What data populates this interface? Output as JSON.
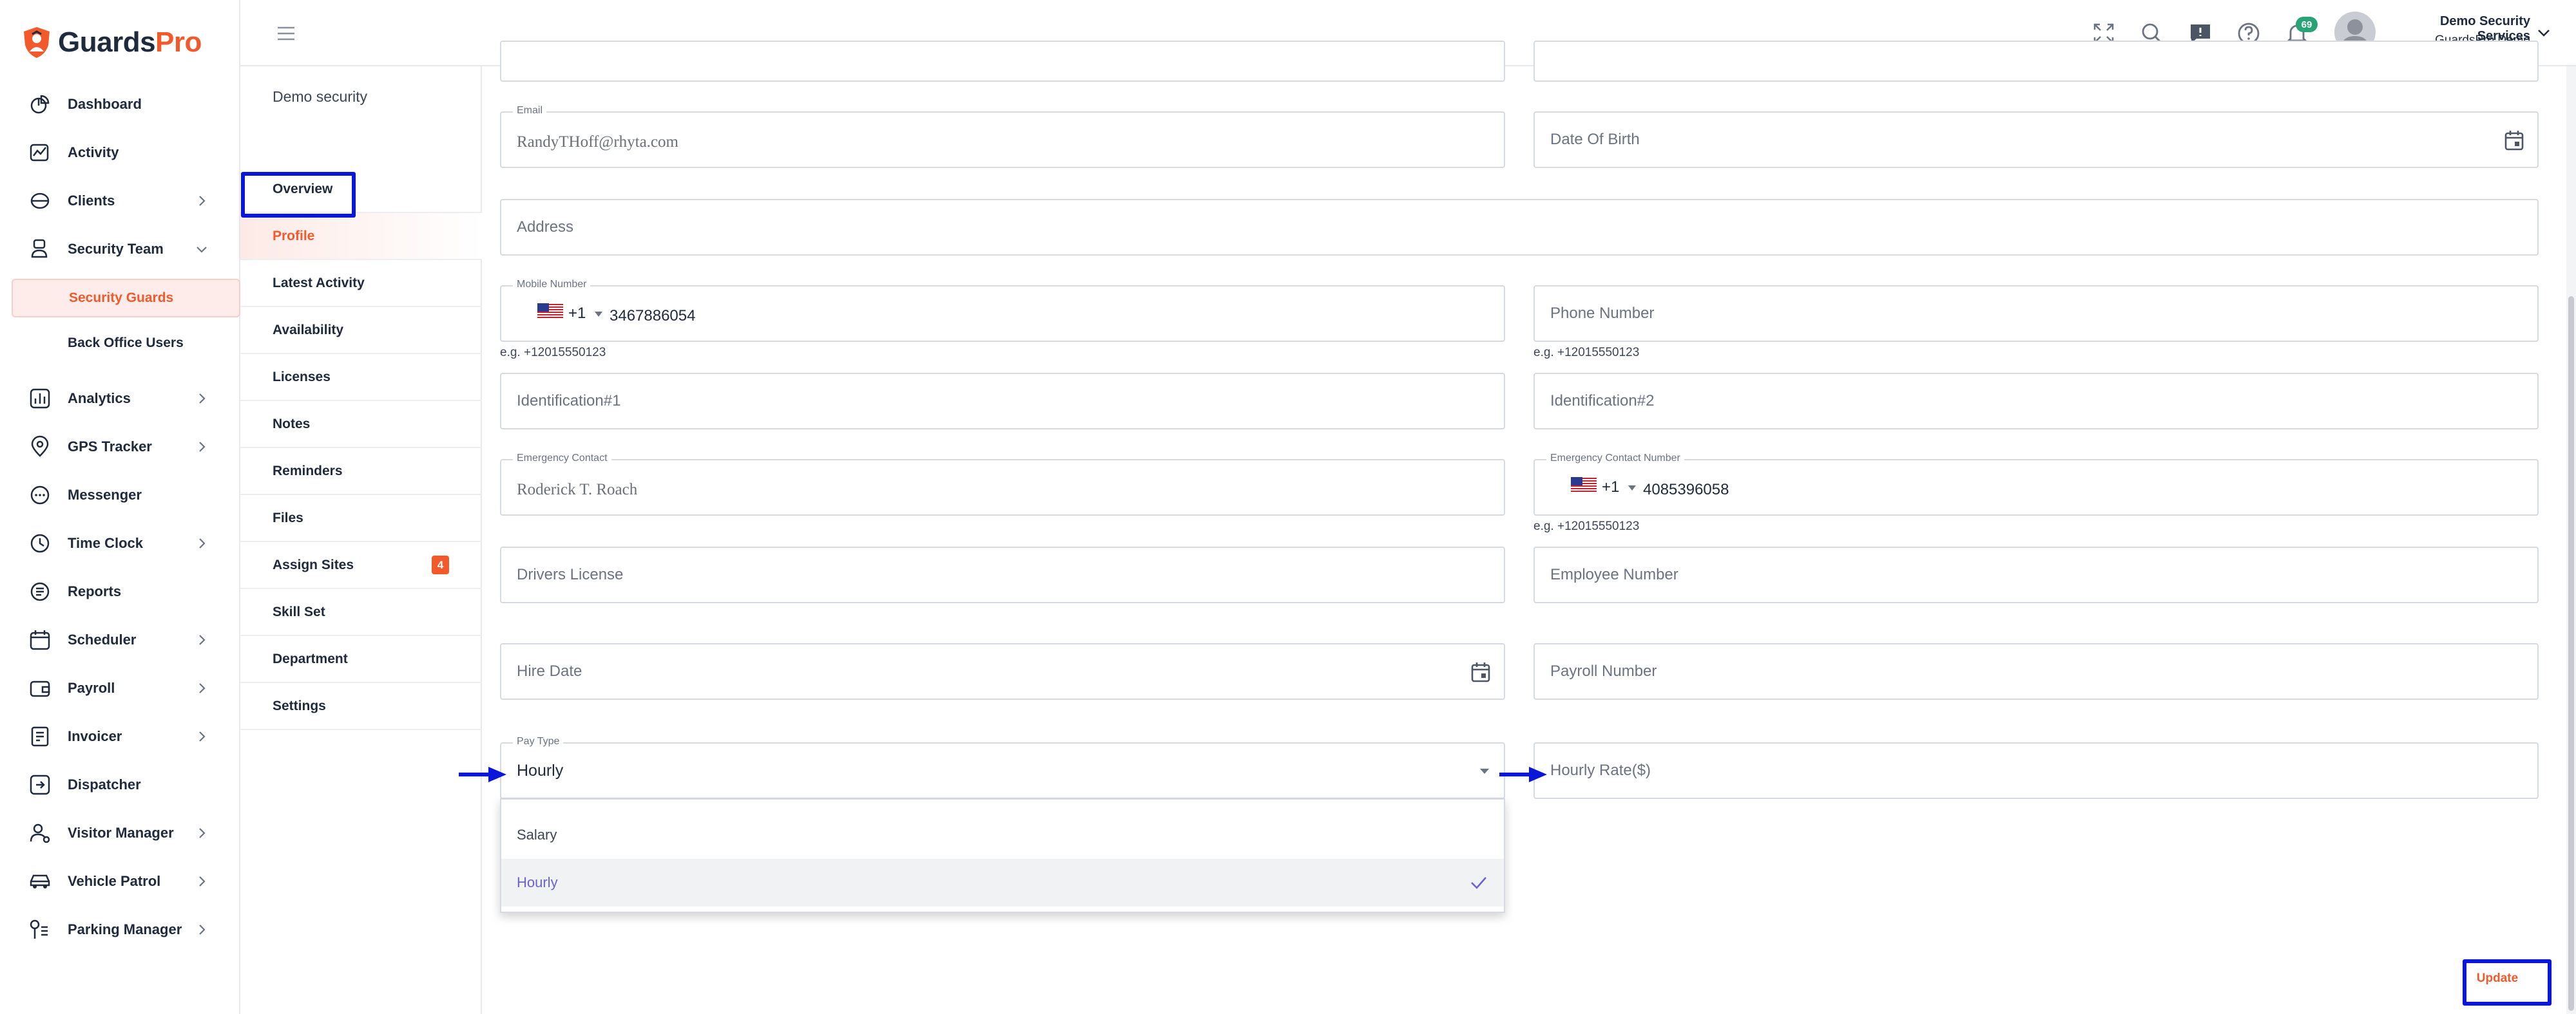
{
  "brand": {
    "name_part1": "Guards",
    "name_part2": "Pro",
    "primary_color": "#f25a2c",
    "text_color": "#1f2b3d",
    "highlight_color": "#0a16d8"
  },
  "sidebar": {
    "items": [
      {
        "label": "Dashboard",
        "icon": "dashboard-icon",
        "has_children": false
      },
      {
        "label": "Activity",
        "icon": "activity-icon",
        "has_children": false
      },
      {
        "label": "Clients",
        "icon": "clients-icon",
        "has_children": true
      },
      {
        "label": "Security Team",
        "icon": "security-team-icon",
        "has_children": true,
        "expanded": true
      },
      {
        "label": "Analytics",
        "icon": "analytics-icon",
        "has_children": true
      },
      {
        "label": "GPS Tracker",
        "icon": "gps-icon",
        "has_children": true
      },
      {
        "label": "Messenger",
        "icon": "messenger-icon",
        "has_children": false
      },
      {
        "label": "Time Clock",
        "icon": "clock-icon",
        "has_children": true
      },
      {
        "label": "Reports",
        "icon": "reports-icon",
        "has_children": false
      },
      {
        "label": "Scheduler",
        "icon": "calendar-icon",
        "has_children": true
      },
      {
        "label": "Payroll",
        "icon": "payroll-icon",
        "has_children": true
      },
      {
        "label": "Invoicer",
        "icon": "invoice-icon",
        "has_children": true
      },
      {
        "label": "Dispatcher",
        "icon": "dispatcher-icon",
        "has_children": false
      },
      {
        "label": "Visitor Manager",
        "icon": "visitor-icon",
        "has_children": true
      },
      {
        "label": "Vehicle Patrol",
        "icon": "car-icon",
        "has_children": true
      },
      {
        "label": "Parking Manager",
        "icon": "parking-icon",
        "has_children": true
      }
    ],
    "security_team_children": [
      {
        "label": "Security Guards",
        "active": true
      },
      {
        "label": "Back Office Users",
        "active": false
      }
    ]
  },
  "header": {
    "notification_count": "69",
    "user_company": "Demo Security Services",
    "user_name": "GuardsPro Demo"
  },
  "subnav": {
    "title": "Demo security",
    "items": [
      {
        "label": "Overview"
      },
      {
        "label": "Profile",
        "active": true
      },
      {
        "label": "Latest Activity"
      },
      {
        "label": "Availability"
      },
      {
        "label": "Licenses"
      },
      {
        "label": "Notes"
      },
      {
        "label": "Reminders"
      },
      {
        "label": "Files"
      },
      {
        "label": "Assign Sites",
        "badge": "4"
      },
      {
        "label": "Skill Set"
      },
      {
        "label": "Department"
      },
      {
        "label": "Settings"
      }
    ]
  },
  "form": {
    "email": {
      "label": "Email",
      "value": "RandyTHoff@rhyta.com"
    },
    "dob": {
      "placeholder": "Date Of Birth"
    },
    "address": {
      "placeholder": "Address"
    },
    "mobile": {
      "label": "Mobile Number",
      "dial": "+1",
      "value": "3467886054",
      "hint": "e.g. +12015550123"
    },
    "phone": {
      "placeholder": "Phone Number",
      "hint": "e.g. +12015550123"
    },
    "id1": {
      "placeholder": "Identification#1"
    },
    "id2": {
      "placeholder": "Identification#2"
    },
    "emergency_contact": {
      "label": "Emergency Contact",
      "value": "Roderick T. Roach"
    },
    "emergency_number": {
      "label": "Emergency Contact Number",
      "dial": "+1",
      "value": "4085396058",
      "hint": "e.g. +12015550123"
    },
    "drivers_license": {
      "placeholder": "Drivers License"
    },
    "employee_number": {
      "placeholder": "Employee Number"
    },
    "hire_date": {
      "placeholder": "Hire Date"
    },
    "payroll_number": {
      "placeholder": "Payroll Number"
    },
    "pay_type": {
      "label": "Pay Type",
      "value": "Hourly",
      "options": [
        "Salary",
        "Hourly"
      ],
      "selected": "Hourly"
    },
    "hourly_rate": {
      "placeholder": "Hourly Rate($)"
    },
    "update_label": "Update"
  }
}
